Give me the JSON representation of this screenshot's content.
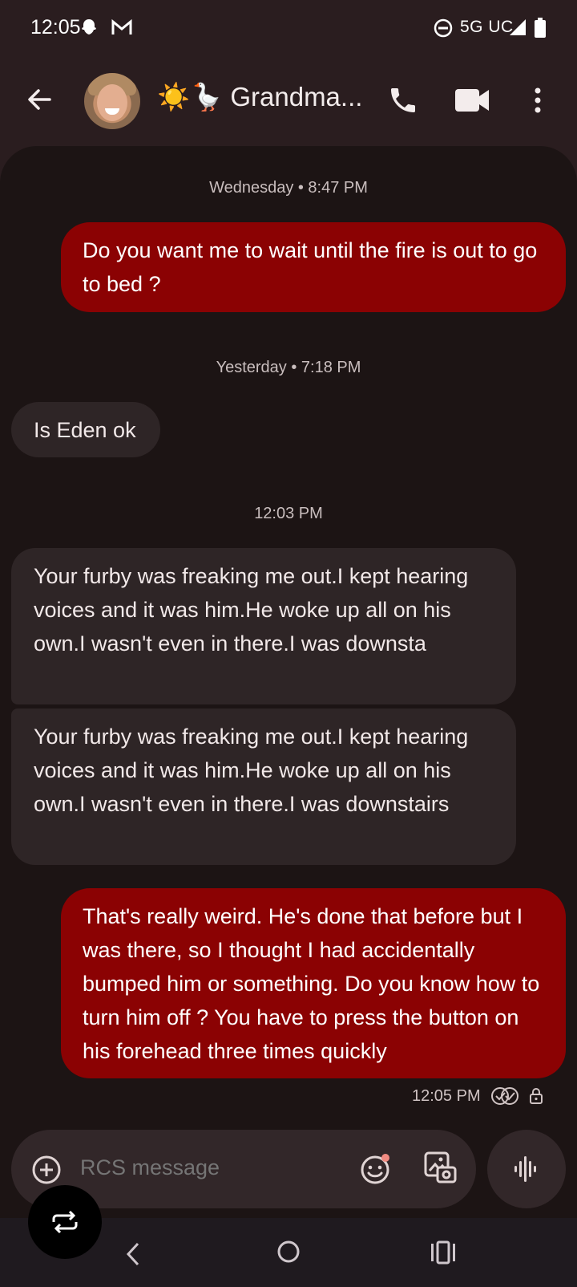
{
  "status_bar": {
    "time": "12:05",
    "network": "5G UC",
    "icons": [
      "snapchat-icon",
      "gmail-icon",
      "do-not-disturb-icon",
      "signal-icon",
      "battery-icon"
    ]
  },
  "app_bar": {
    "contact_name": "☀️🪿 Grandma...",
    "icons": [
      "back-arrow-icon",
      "phone-icon",
      "video-camera-icon",
      "more-vert-icon"
    ]
  },
  "conversation": {
    "timestamps": [
      "Wednesday • 8:47 PM",
      "Yesterday • 7:18 PM",
      "12:03 PM"
    ],
    "messages": [
      {
        "direction": "outgoing",
        "text": "Do you want me to wait until the fire is out to go to bed ?"
      },
      {
        "direction": "incoming",
        "text": "Is Eden ok"
      },
      {
        "direction": "incoming",
        "text": "Your furby was freaking me out.I kept hearing voices and it was him.He woke up all on his own.I wasn't even in there.I was downsta"
      },
      {
        "direction": "incoming",
        "text": "Your furby was freaking me out.I kept hearing voices and it was him.He woke up all on his own.I wasn't even in there.I was downstairs"
      },
      {
        "direction": "outgoing",
        "text": "That's really weird. He's done that before but I was there, so I thought I had accidentally bumped him or something. Do you know how to turn him off ? You have to press the button on his forehead three times quickly"
      }
    ],
    "last_message_time": "12:05 PM"
  },
  "composer": {
    "placeholder": "RCS message"
  },
  "colors": {
    "outgoing_bubble": "#8b0203",
    "incoming_bubble": "#2e2526",
    "chat_background": "#1c1414",
    "app_background": "#2a1d1f"
  }
}
